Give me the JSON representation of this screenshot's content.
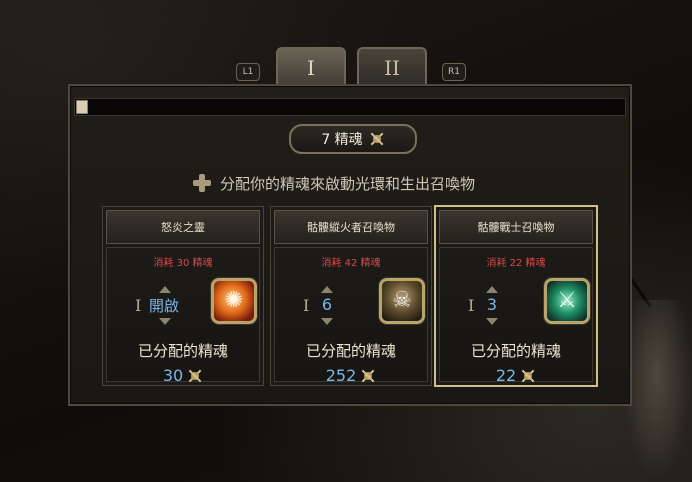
{
  "tabs": {
    "left_bumper": "L1",
    "right_bumper": "R1",
    "items": [
      {
        "label": "I"
      },
      {
        "label": "II"
      }
    ]
  },
  "essence": {
    "count_label": "7 精魂",
    "icon": "essence-icon"
  },
  "hint": {
    "icon": "dpad-icon",
    "text": "分配你的精魂來啟動光環和生出召喚物"
  },
  "cards": [
    {
      "title": "怒炎之靈",
      "cost": "消耗 30 精魂",
      "tier": "I",
      "level": "開啟",
      "icon": "fire-spirit-icon",
      "allocated_label": "已分配的精魂",
      "allocated_value": "30"
    },
    {
      "title": "骷髏縱火者召喚物",
      "cost": "消耗 42 精魂",
      "tier": "I",
      "level": "6",
      "icon": "skeleton-arsonist-icon",
      "allocated_label": "已分配的精魂",
      "allocated_value": "252"
    },
    {
      "title": "骷髏戰士召喚物",
      "cost": "消耗 22 精魂",
      "tier": "I",
      "level": "3",
      "icon": "skeleton-warrior-icon",
      "allocated_label": "已分配的精魂",
      "allocated_value": "22"
    }
  ],
  "colors": {
    "cost_red": "#d9484a",
    "value_blue": "#7ab6e6",
    "selected_border": "#d2c08a"
  }
}
